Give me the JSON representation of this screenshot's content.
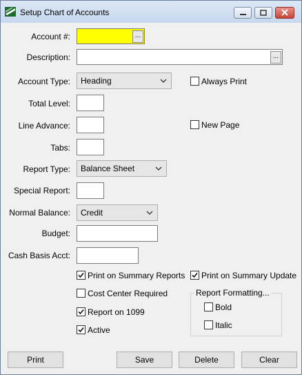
{
  "window": {
    "title": "Setup Chart of Accounts"
  },
  "labels": {
    "account_num": "Account #:",
    "description": "Description:",
    "account_type": "Account Type:",
    "total_level": "Total Level:",
    "line_advance": "Line Advance:",
    "tabs": "Tabs:",
    "report_type": "Report Type:",
    "special_report": "Special Report:",
    "normal_balance": "Normal Balance:",
    "budget": "Budget:",
    "cash_basis_acct": "Cash Basis Acct:"
  },
  "fields": {
    "account_num": "",
    "description": "",
    "total_level": "",
    "line_advance": "",
    "tabs": "",
    "special_report": "",
    "budget": "",
    "cash_basis_acct": "",
    "account_type": "Heading",
    "report_type": "Balance Sheet",
    "normal_balance": "Credit",
    "ellipsis": "..."
  },
  "checkboxes": {
    "always_print": {
      "label": "Always Print",
      "checked": false
    },
    "new_page": {
      "label": "New Page",
      "checked": false
    },
    "print_summary_reports": {
      "label": "Print on Summary Reports",
      "checked": true
    },
    "print_summary_update": {
      "label": "Print on Summary Update",
      "checked": true
    },
    "cost_center_required": {
      "label": "Cost Center Required",
      "checked": false
    },
    "report_1099": {
      "label": "Report on 1099",
      "checked": true
    },
    "active": {
      "label": "Active",
      "checked": true
    },
    "bold": {
      "label": "Bold",
      "checked": false
    },
    "italic": {
      "label": "Italic",
      "checked": false
    }
  },
  "report_formatting": {
    "title": "Report Formatting..."
  },
  "buttons": {
    "print": "Print",
    "save": "Save",
    "delete": "Delete",
    "clear": "Clear"
  },
  "colors": {
    "account_field_bg": "#ffff00",
    "titlebar": "#c7d8ee",
    "close_button": "#c8453a"
  }
}
